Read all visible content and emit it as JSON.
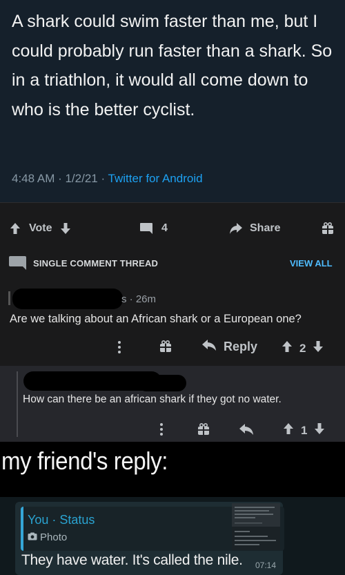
{
  "tweet": {
    "text": "A shark could swim faster than me, but I could probably run faster than a shark. So in a triathlon, it would all come down to who is the better cyclist.",
    "time": "4:48 AM · 1/2/21 · ",
    "source": "Twitter for Android"
  },
  "actionbar": {
    "vote_label": "Vote",
    "comment_count": "4",
    "share_label": "Share"
  },
  "thread": {
    "label": "SINGLE COMMENT THREAD",
    "view_all": "VIEW ALL"
  },
  "comment1": {
    "time": "s · 26m",
    "body": "Are we talking about an African shark or a European one?",
    "reply_label": "Reply",
    "score": "2"
  },
  "comment2": {
    "body": "How can there be an african shark if they got no water.",
    "score": "1"
  },
  "caption": "my friend's reply:",
  "chat": {
    "quote_author": "You · Status",
    "quote_type": "Photo",
    "reply": "They have water. It's called the nile.",
    "time": "07:14"
  }
}
